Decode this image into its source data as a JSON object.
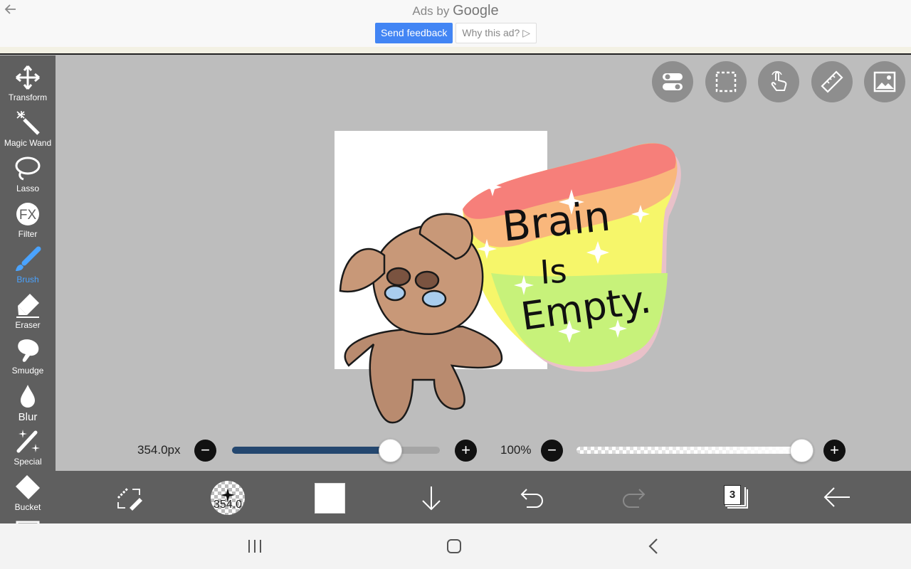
{
  "ad": {
    "back_icon": "back-arrow-icon",
    "title_prefix": "Ads by",
    "title_brand": "Google",
    "send_feedback": "Send feedback",
    "why_this_ad": "Why this ad?",
    "why_icon": "▷"
  },
  "tools": [
    {
      "label": "Transform",
      "icon": "transform-icon"
    },
    {
      "label": "Magic Wand",
      "icon": "magic-wand-icon"
    },
    {
      "label": "Lasso",
      "icon": "lasso-icon"
    },
    {
      "label": "Filter",
      "icon": "fx-icon",
      "glyph": "FX"
    },
    {
      "label": "Brush",
      "icon": "brush-icon",
      "active": true
    },
    {
      "label": "Eraser",
      "icon": "eraser-icon"
    },
    {
      "label": "Smudge",
      "icon": "smudge-icon"
    },
    {
      "label": "Blur",
      "icon": "blur-icon"
    },
    {
      "label": "Special",
      "icon": "special-icon"
    },
    {
      "label": "Bucket",
      "icon": "bucket-icon"
    }
  ],
  "quick_tools": [
    "toggle-icon",
    "selection-icon",
    "touch-icon",
    "ruler-icon",
    "image-icon"
  ],
  "artwork": {
    "text_lines": [
      "Brain",
      "Is",
      "Empty."
    ]
  },
  "brush_size": {
    "value": "354.0px",
    "fraction": 0.76,
    "minus": "−",
    "plus": "+"
  },
  "opacity": {
    "value": "100%",
    "fraction": 1.0,
    "minus": "−",
    "plus": "+"
  },
  "bottom": {
    "brush_preview_value": "354.0",
    "layers_count": "3",
    "color": "#ffffff"
  },
  "colors": {
    "accent": "#4aa3ff",
    "toolbar": "#5f5f5f",
    "canvas_bg": "#bdbdbd",
    "feedback_btn": "#4285f4",
    "slider_fill": "#24476f"
  }
}
